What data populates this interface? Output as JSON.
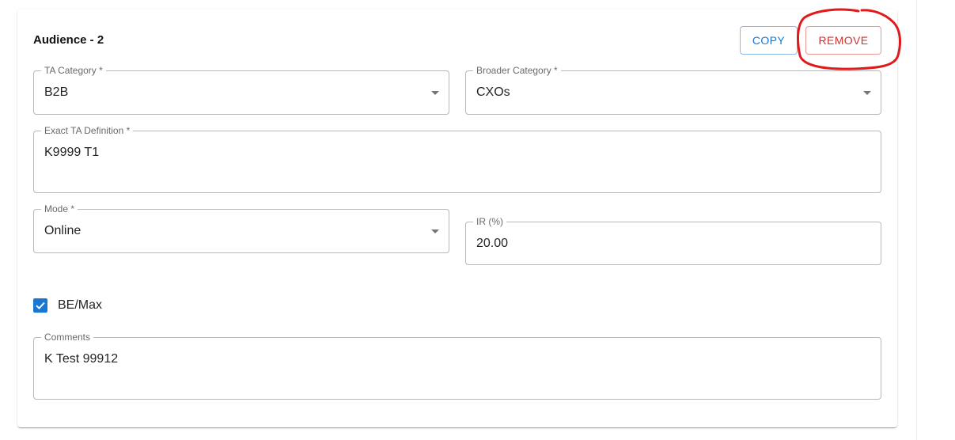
{
  "card": {
    "title": "Audience - 2",
    "copy_label": "COPY",
    "remove_label": "REMOVE"
  },
  "fields": {
    "ta_category": {
      "label": "TA Category *",
      "value": "B2B"
    },
    "broader_category": {
      "label": "Broader Category *",
      "value": "CXOs"
    },
    "exact_ta_definition": {
      "label": "Exact TA Definition *",
      "value": "K9999 T1"
    },
    "mode": {
      "label": "Mode *",
      "value": "Online"
    },
    "ir": {
      "label": "IR (%)",
      "value": "20.00"
    },
    "comments": {
      "label": "Comments",
      "value": "K Test 99912"
    }
  },
  "be_max": {
    "label": "BE/Max",
    "checked": true
  },
  "icons": {
    "dropdown": "arrow-drop-down-icon",
    "checkbox": "checkbox-checked-icon"
  },
  "colors": {
    "primary": "#1976d2",
    "error": "#d32f2f",
    "annotation": "#e0191b"
  }
}
